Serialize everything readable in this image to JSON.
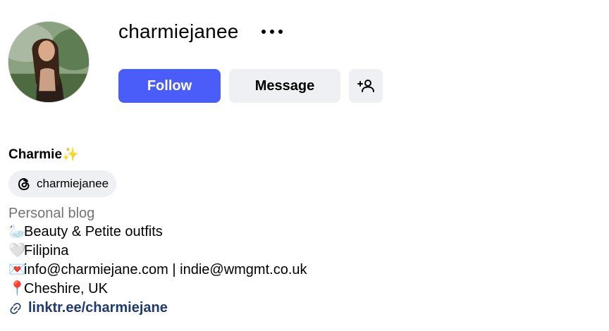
{
  "profile": {
    "username": "charmiejanee",
    "display_name": "Charmie✨",
    "threads_handle": "charmiejanee",
    "category": "Personal blog",
    "bio_lines": [
      {
        "emoji": "🦢",
        "text": "Beauty & Petite outfits"
      },
      {
        "emoji": "🤍",
        "text": "Filipina"
      },
      {
        "emoji": "💌",
        "text": "info@charmiejane.com | indie@wmgmt.co.uk"
      },
      {
        "emoji": "📍",
        "text": "Cheshire, UK"
      }
    ],
    "link": "linktr.ee/charmiejane"
  },
  "actions": {
    "follow_label": "Follow",
    "message_label": "Message"
  },
  "icons": {
    "more": "more-options-icon",
    "add_user": "add-user-icon",
    "threads": "threads-icon",
    "link": "link-icon"
  },
  "colors": {
    "follow_bg": "#4a5df9",
    "secondary_bg": "#eff0f3",
    "muted_text": "#737373",
    "link_text": "#1f3a6e"
  }
}
